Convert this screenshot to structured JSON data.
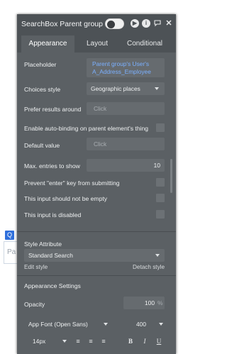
{
  "background": {
    "search_icon": "search-icon",
    "input_placeholder": "Pa"
  },
  "panel": {
    "title": "SearchBox Parent group",
    "tabs": [
      "Appearance",
      "Layout",
      "Conditional"
    ],
    "fields": {
      "placeholder_label": "Placeholder",
      "placeholder_value": "Parent group's User's A_Address_Employee",
      "choices_style_label": "Choices style",
      "choices_style_value": "Geographic places",
      "prefer_results_label": "Prefer results around",
      "prefer_results_value": "Click",
      "auto_binding_label": "Enable auto-binding on parent element's thing",
      "default_value_label": "Default value",
      "default_value_value": "Click",
      "max_entries_label": "Max. entries to show",
      "max_entries_value": "10",
      "prevent_enter_label": "Prevent \"enter\" key from submitting",
      "not_empty_label": "This input should not be empty",
      "disabled_label": "This input is disabled",
      "style_attribute_label": "Style Attribute",
      "style_value": "Standard Search",
      "edit_style": "Edit style",
      "detach_style": "Detach style",
      "appearance_settings_label": "Appearance Settings",
      "opacity_label": "Opacity",
      "opacity_value": "100",
      "opacity_unit": "%",
      "font_value": "App Font (Open Sans)",
      "font_weight": "400",
      "font_size": "14px"
    },
    "formatting": {
      "align_left": "≡",
      "align_center": "≡",
      "align_right": "≡",
      "bold": "B",
      "italic": "I",
      "underline": "U"
    },
    "icons": {
      "toggle": "toggle-icon",
      "play": "play-icon",
      "info": "info-icon",
      "comment": "comment-icon",
      "close": "close-icon"
    }
  }
}
